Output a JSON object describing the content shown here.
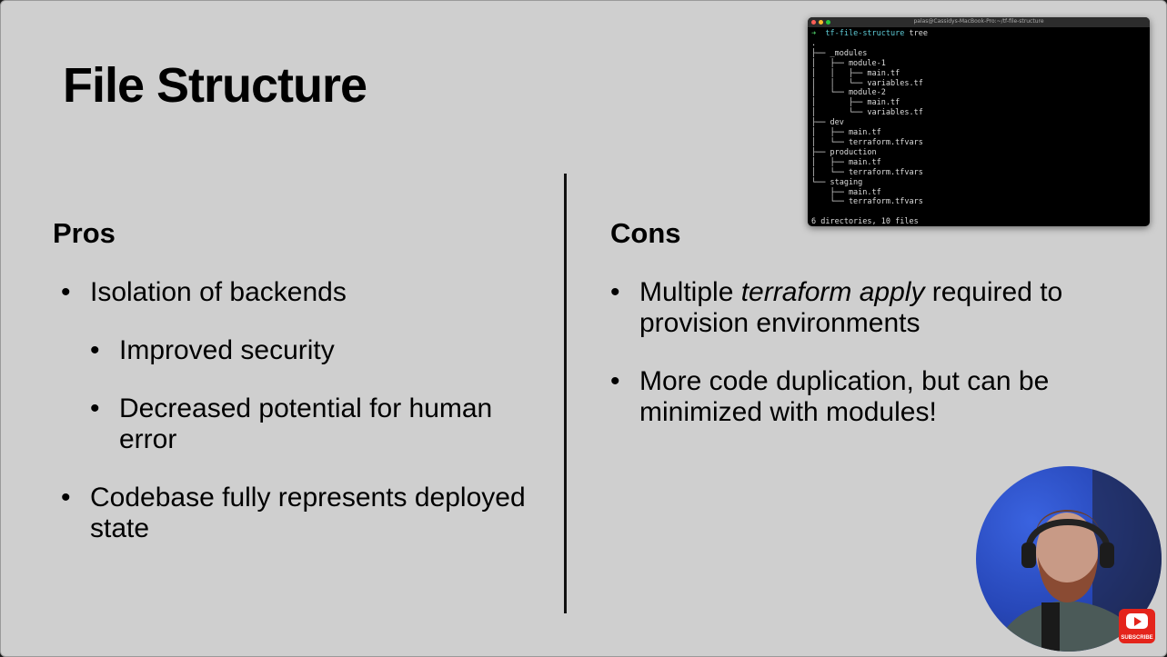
{
  "slide": {
    "title": "File Structure",
    "pros": {
      "heading": "Pros",
      "items": [
        {
          "text": "Isolation of backends",
          "level": 1
        },
        {
          "text": "Improved security",
          "level": 2
        },
        {
          "text": "Decreased potential for human error",
          "level": 2
        },
        {
          "text": "Codebase fully represents deployed state",
          "level": 1
        }
      ]
    },
    "cons": {
      "heading": "Cons",
      "item1_pre": "Multiple ",
      "item1_em": "terraform apply",
      "item1_post": " required to provision environments",
      "item2": "More code duplication, but can be minimized with modules!"
    }
  },
  "terminal": {
    "window_title": "palas@Cassidys-MacBook-Pro:~/tf-file-structure",
    "prompt_symbol": "➜",
    "prompt_dir": "tf-file-structure",
    "command": "tree",
    "lines": [
      ".",
      "├── _modules",
      "│   ├── module-1",
      "│   │   ├── main.tf",
      "│   │   └── variables.tf",
      "│   └── module-2",
      "│       ├── main.tf",
      "│       └── variables.tf",
      "├── dev",
      "│   ├── main.tf",
      "│   └── terraform.tfvars",
      "├── production",
      "│   ├── main.tf",
      "│   └── terraform.tfvars",
      "└── staging",
      "    ├── main.tf",
      "    └── terraform.tfvars",
      "",
      "6 directories, 10 files"
    ],
    "colors": {
      "close": "#ff5f57",
      "minimize": "#febc2e",
      "maximize": "#28c840"
    }
  },
  "overlay": {
    "subscribe_label": "SUBSCRIBE",
    "webcam_icon": "webcam-presenter",
    "youtube_icon": "youtube-play-icon"
  }
}
